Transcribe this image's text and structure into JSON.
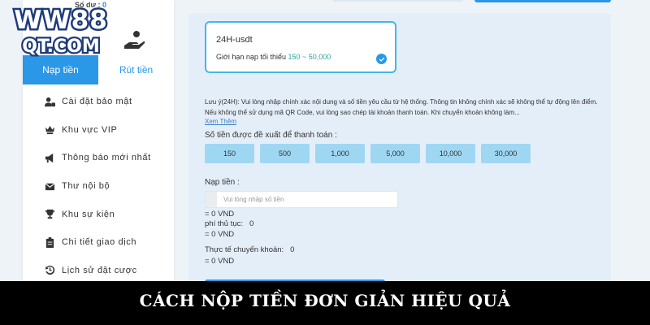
{
  "header": {
    "balance_label": "Số dư :",
    "balance_value": "0"
  },
  "logo": {
    "line1": "WW88",
    "line2": "QT.COM",
    "icon": "ww88-logo"
  },
  "tabs": [
    {
      "label": "Nạp tiền",
      "active": true
    },
    {
      "label": "Rút tiền",
      "active": false,
      "icon": "hand-coin-icon"
    }
  ],
  "sidebar": {
    "items": [
      {
        "label": "Cài đặt bảo mật",
        "icon": "user-lock-icon"
      },
      {
        "label": "Khu vực VIP",
        "icon": "crown-vip-icon"
      },
      {
        "label": "Thông báo mới nhất",
        "icon": "megaphone-icon"
      },
      {
        "label": "Thư nội bộ",
        "icon": "envelope-icon"
      },
      {
        "label": "Khu sự kiện",
        "icon": "trophy-icon"
      },
      {
        "label": "Chi tiết giao dịch",
        "icon": "clipboard-icon"
      },
      {
        "label": "Lịch sử đặt cược",
        "icon": "history-icon"
      }
    ]
  },
  "payment_method": {
    "name": "24H-usdt",
    "limit_label": "Giới hạn nạp tối thiểu",
    "limit_range": "150 ~ 50,000",
    "selected": true
  },
  "note": {
    "text": "Lưu ý(24H): Vui lòng nhập chính xác nội dung và số tiền yêu cầu từ hệ thống. Thông tin không chính xác sẽ không thể tự động lên điểm. Nếu không thể sử dụng mã QR Code, vui lòng sao chép tài khoản thanh toán. Khi chuyển khoản không làm...",
    "see_more": "Xem Thêm"
  },
  "suggested": {
    "label": "Số tiền được đề xuất để thanh toán :",
    "amounts": [
      "150",
      "500",
      "1,000",
      "5,000",
      "10,000",
      "30,000"
    ]
  },
  "deposit": {
    "label": "Nạp tiền :",
    "placeholder": "Vui lòng nhập số tiền",
    "amount_vnd": "= 0 VND",
    "fee_label": "phí thủ tục:",
    "fee_value": "0",
    "fee_vnd": "= 0 VND",
    "actual_label": "Thực tế chuyển khoản:",
    "actual_value": "0",
    "actual_vnd": "= 0 VND"
  },
  "banner": {
    "title": "CÁCH NỘP TIỀN ĐƠN GIẢN HIỆU QUẢ"
  },
  "colors": {
    "accent": "#2a98e6",
    "amount_button": "#9fd7f3",
    "banner_bg": "#000000"
  }
}
